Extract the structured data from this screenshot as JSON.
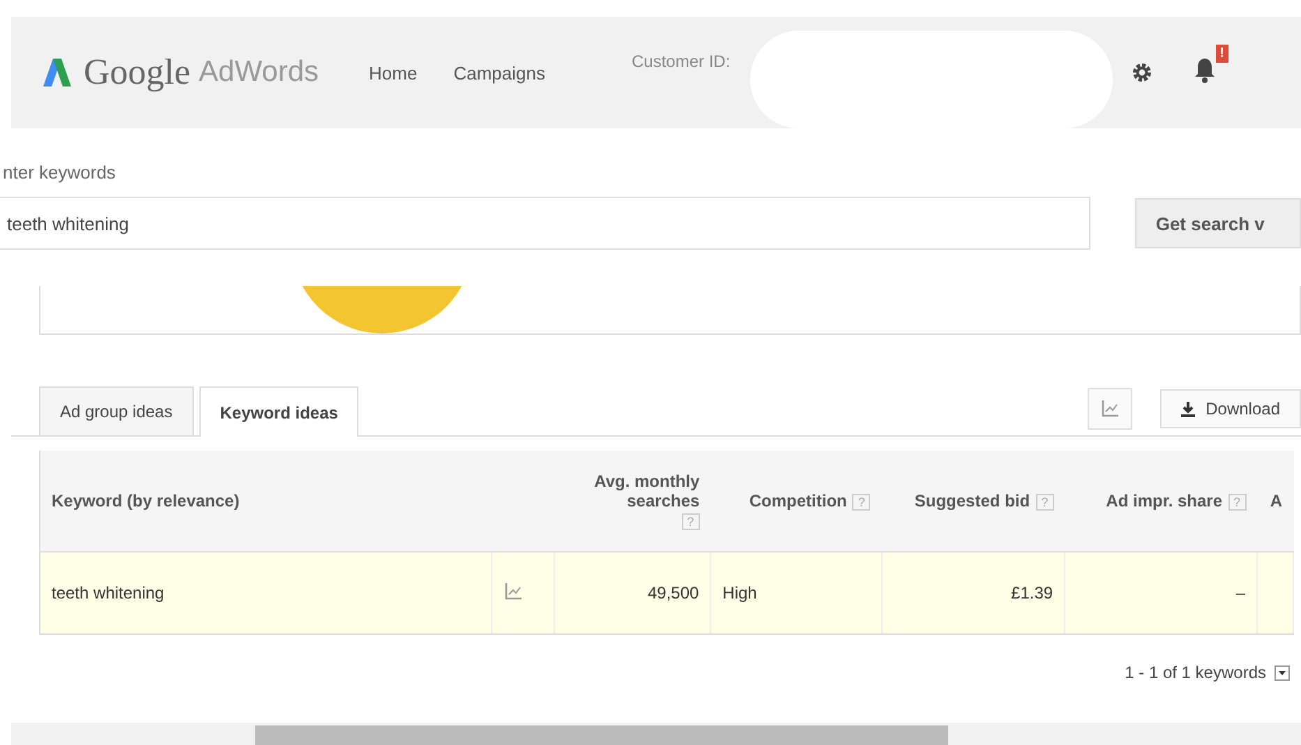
{
  "header": {
    "logo_google": "Google",
    "logo_product": "AdWords",
    "nav": [
      {
        "label": "Home",
        "selected": false
      },
      {
        "label": "Campaigns",
        "selected": false
      }
    ],
    "customer_id_label": "Customer ID:",
    "notification_badge": "!"
  },
  "search": {
    "label": "nter keywords",
    "value": "teeth whitening",
    "button": "Get search v"
  },
  "tabs": [
    {
      "label": "Ad group ideas",
      "selected": false
    },
    {
      "label": "Keyword ideas",
      "selected": true
    }
  ],
  "toolbar": {
    "download": "Download"
  },
  "table": {
    "columns": [
      {
        "label": "Keyword (by relevance)"
      },
      {
        "label": "Avg. monthly searches",
        "help": "?"
      },
      {
        "label": "Competition",
        "help": "?"
      },
      {
        "label": "Suggested bid",
        "help": "?"
      },
      {
        "label": "Ad impr. share",
        "help": "?"
      },
      {
        "label": "A"
      }
    ],
    "rows": [
      {
        "keyword": "teeth whitening",
        "searches": "49,500",
        "competition": "High",
        "bid": "£1.39",
        "share": "–"
      }
    ]
  },
  "pagination": "1 - 1 of 1 keywords"
}
